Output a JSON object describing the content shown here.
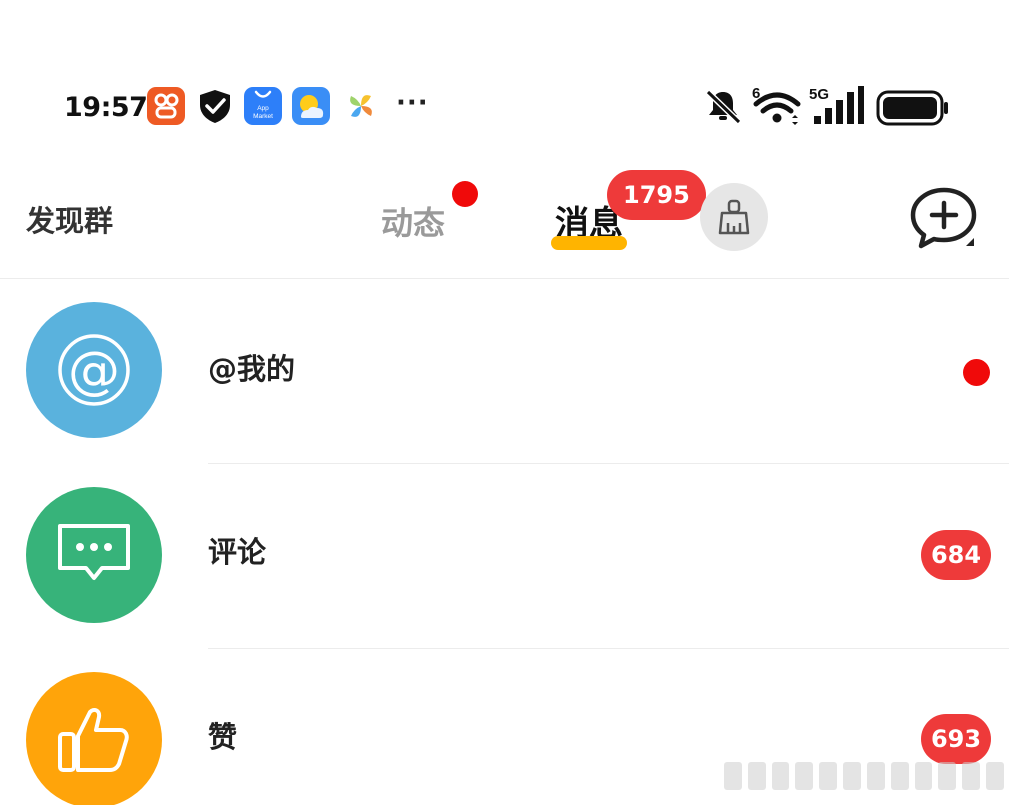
{
  "status_bar": {
    "time": "19:57",
    "app_icons": [
      "taobao-icon",
      "shield-check-icon",
      "app-market-icon",
      "weather-icon",
      "pinwheel-icon"
    ],
    "app_market_label_line1": "App",
    "app_market_label_line2": "Market",
    "more": "···",
    "wifi_label": "6",
    "network_label": "5G"
  },
  "top_nav": {
    "discover_label": "发现群",
    "tab_feed_label": "动态",
    "tab_messages_label": "消息",
    "messages_badge": "1795"
  },
  "messages": [
    {
      "label": "@我的",
      "indicator": "dot",
      "icon": "at-sign-icon",
      "color": "#5ab2dd"
    },
    {
      "label": "评论",
      "badge": "684",
      "icon": "comment-bubble-icon",
      "color": "#37b37a"
    },
    {
      "label": "赞",
      "badge": "693",
      "icon": "thumbs-up-icon",
      "color": "#ffa40a"
    }
  ],
  "colors": {
    "accent_yellow": "#ffb400",
    "badge_red": "#ee3a3a",
    "dot_red": "#f00a0a"
  }
}
